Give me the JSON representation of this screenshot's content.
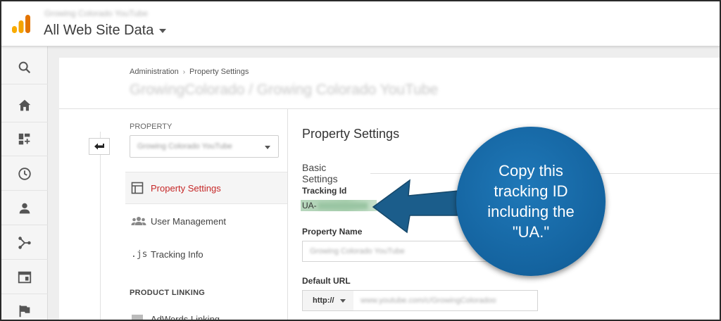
{
  "header": {
    "account_name": "Growing Colorado YouTube",
    "view_selector": "All Web Site Data"
  },
  "left_nav": {
    "icons": [
      "search-icon",
      "home-icon",
      "customization-icon",
      "clock-icon",
      "person-icon",
      "acquisition-icon",
      "behavior-icon",
      "flag-icon"
    ]
  },
  "breadcrumb": {
    "items": [
      "Administration",
      "Property Settings"
    ]
  },
  "page_title": "GrowingColorado / Growing Colorado YouTube",
  "property_panel": {
    "label": "PROPERTY",
    "selected_property": "Growing Colorado YouTube",
    "menu": [
      {
        "label": "Property Settings",
        "icon": "layout-icon",
        "active": true
      },
      {
        "label": "User Management",
        "icon": "users-icon",
        "active": false
      },
      {
        "label": "Tracking Info",
        "icon": "js-icon",
        "active": false
      }
    ],
    "product_linking_label": "PRODUCT LINKING",
    "linking_items": [
      {
        "label": "AdWords Linking",
        "icon": "adwords-icon"
      }
    ]
  },
  "settings": {
    "title": "Property Settings",
    "section": "Basic Settings",
    "tracking_id_label": "Tracking Id",
    "tracking_id_value": "UA-",
    "property_name_label": "Property Name",
    "property_name_value": "Growing Colorado YouTube",
    "default_url_label": "Default URL",
    "protocol_value": "http://",
    "url_value": "www.youtube.com/c/GrowingColoradoo"
  },
  "callout": {
    "text": "Copy this tracking ID including the \"UA.\"",
    "color": "#14639f"
  },
  "colors": {
    "active_menu_text": "#c62828",
    "logo_orange": "#f4a300"
  }
}
